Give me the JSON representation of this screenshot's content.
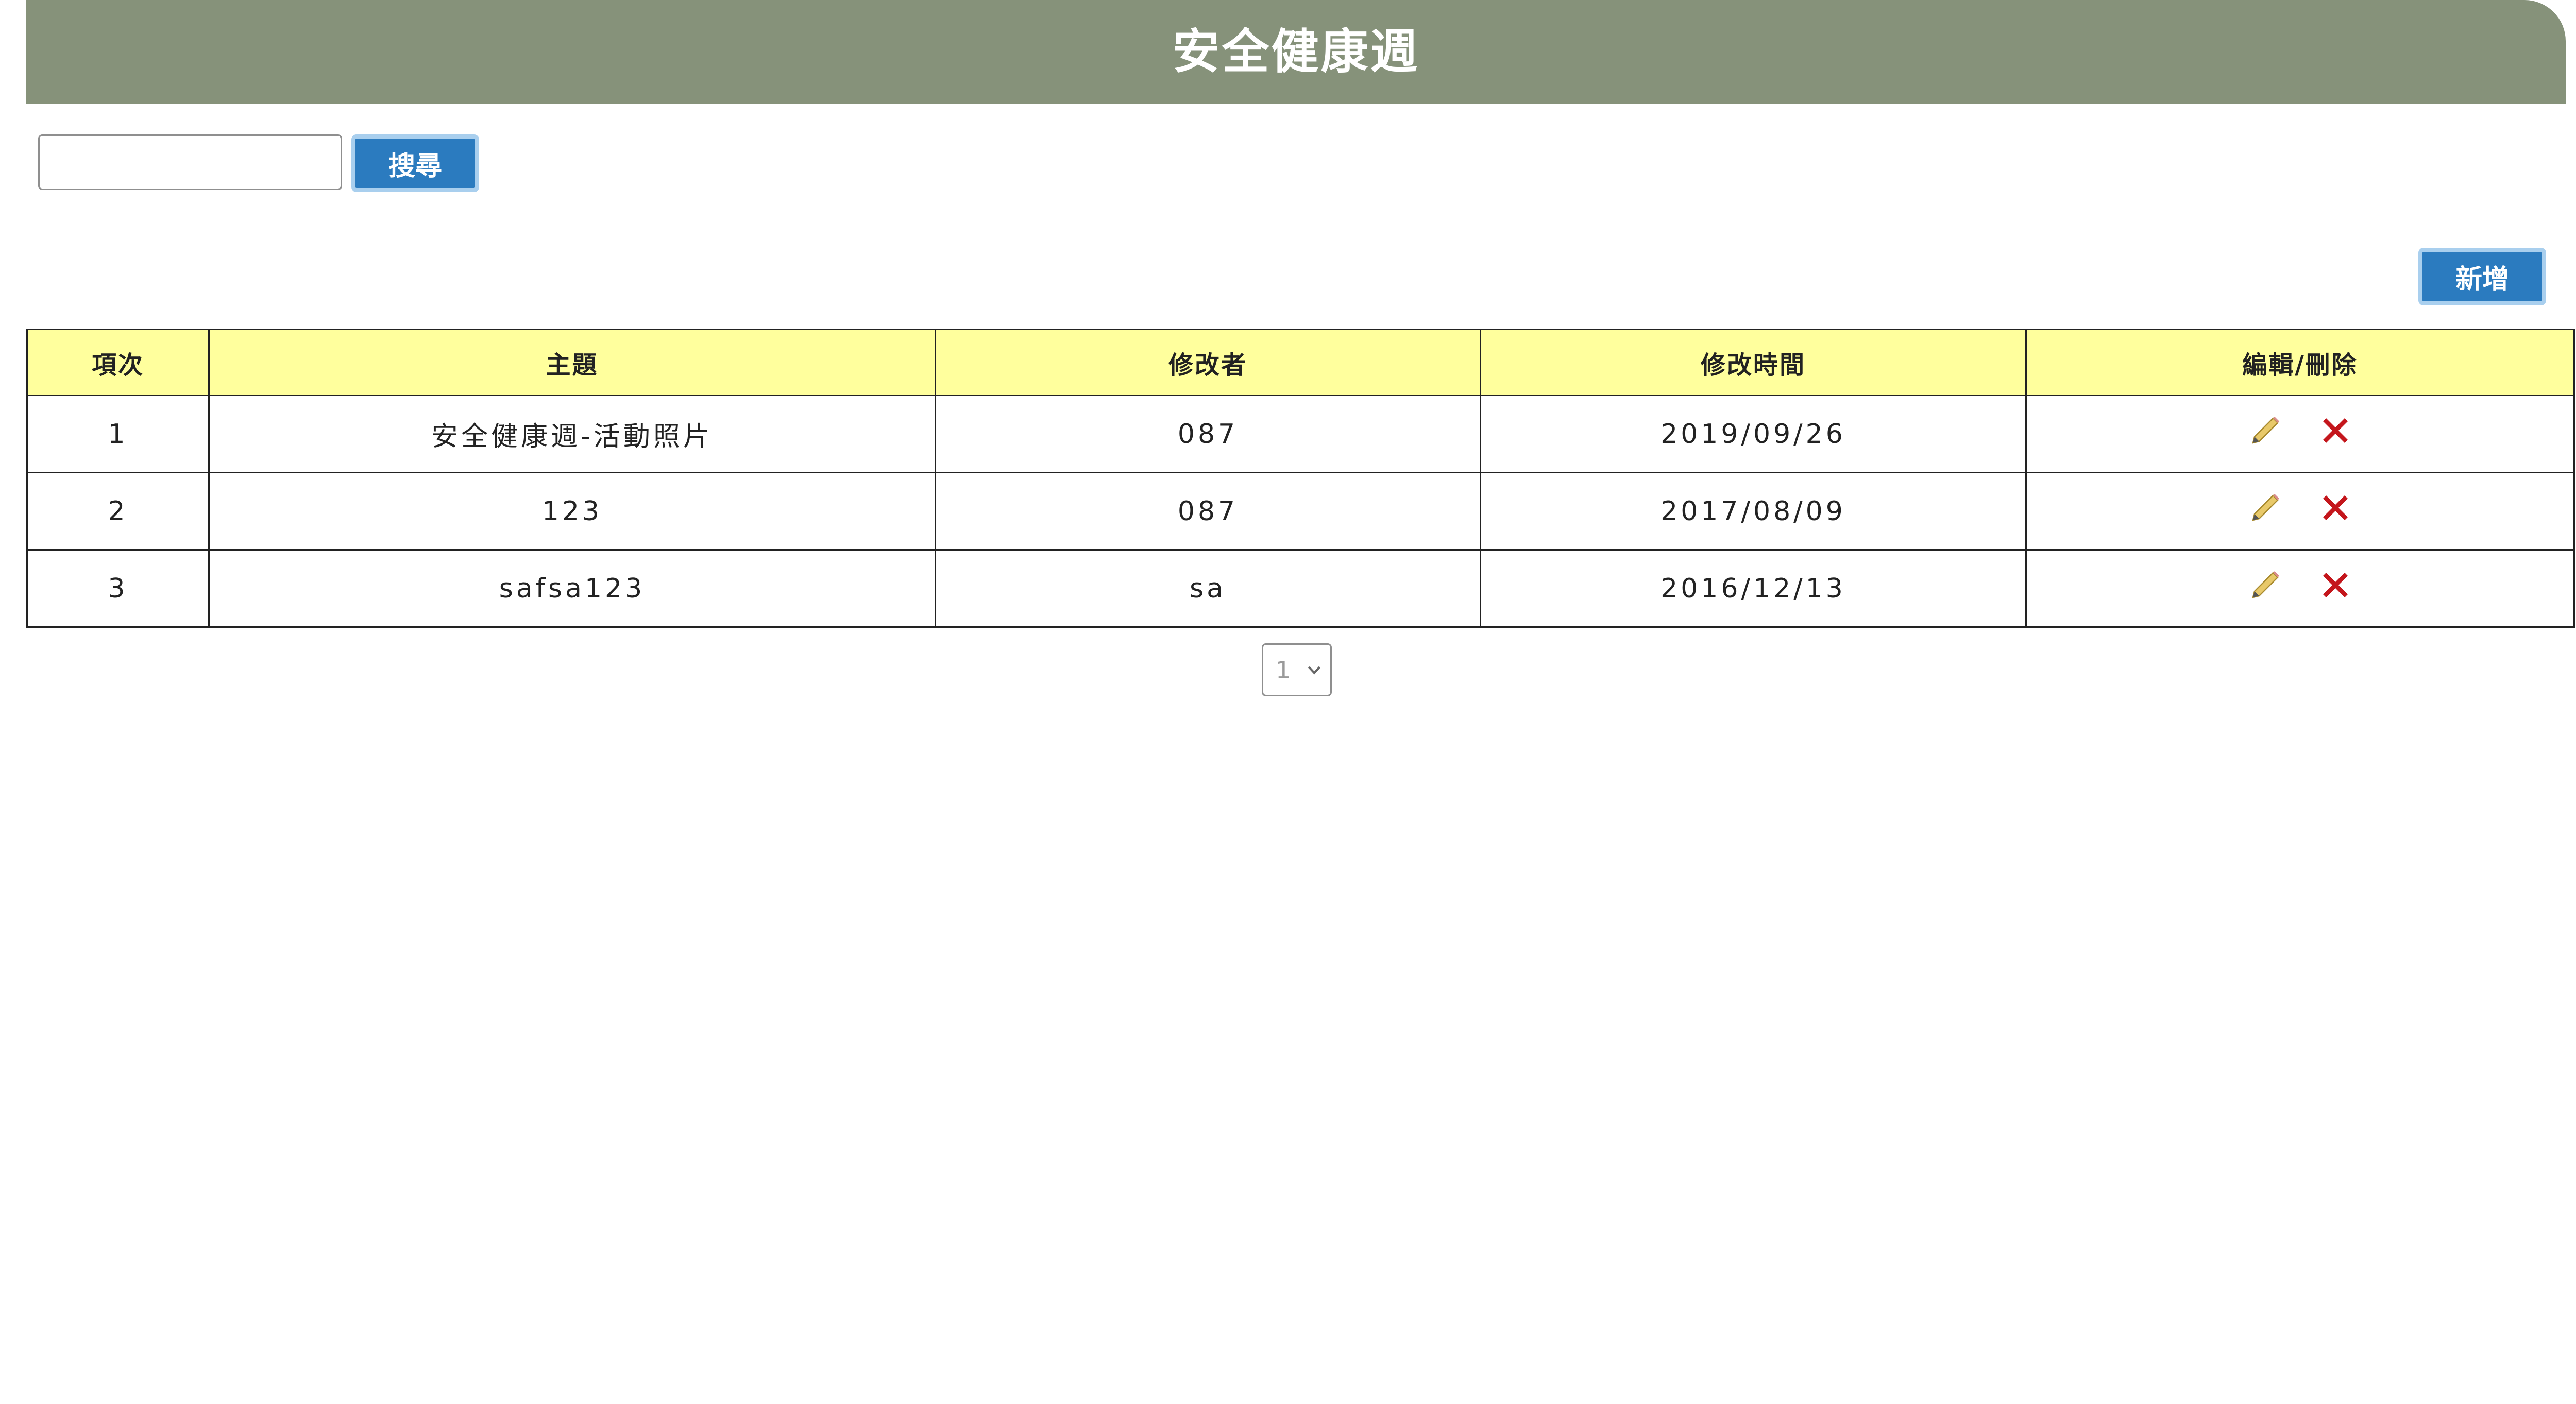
{
  "header": {
    "title": "安全健康週"
  },
  "search": {
    "value": "",
    "placeholder": "",
    "button_label": "搜尋"
  },
  "toolbar": {
    "add_label": "新增"
  },
  "table": {
    "columns": [
      "項次",
      "主題",
      "修改者",
      "修改時間",
      "編輯/刪除"
    ],
    "rows": [
      {
        "no": "1",
        "subject": "安全健康週-活動照片",
        "editor": "087",
        "time": "2019/09/26"
      },
      {
        "no": "2",
        "subject": "123",
        "editor": "087",
        "time": "2017/08/09"
      },
      {
        "no": "3",
        "subject": "safsa123",
        "editor": "sa",
        "time": "2016/12/13"
      }
    ],
    "row_actions": [
      {
        "icon": "pencil-icon"
      },
      {
        "icon": "delete-x-icon",
        "color": "#c4161c"
      }
    ]
  },
  "pagination": {
    "selected_page": "1"
  },
  "colors": {
    "header_bg": "#86927a",
    "table_header_bg": "#ffff9d",
    "button_bg": "#2b7bbf",
    "delete_red": "#c4161c"
  }
}
